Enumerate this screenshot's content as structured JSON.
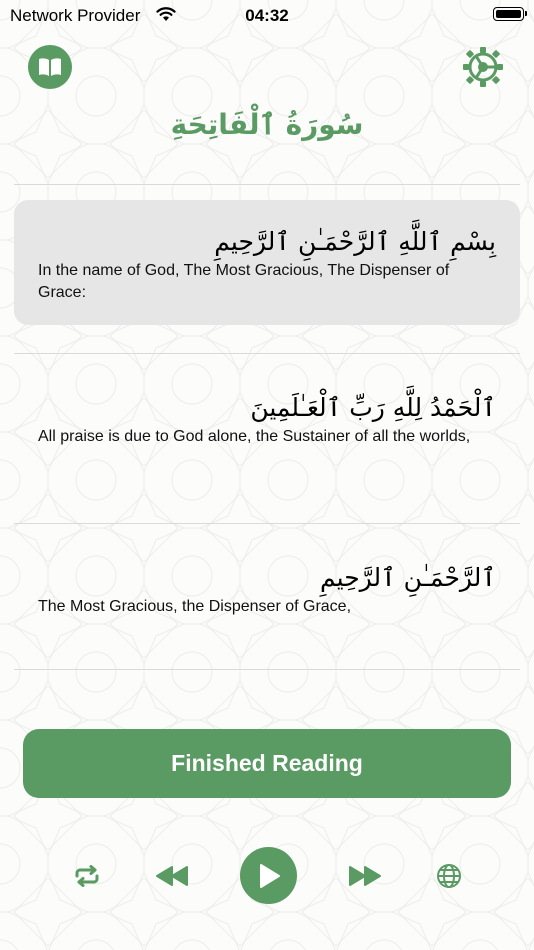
{
  "status_bar": {
    "carrier": "Network Provider",
    "time": "04:32"
  },
  "header": {
    "book_icon": "book-icon",
    "settings_icon": "gear-icon",
    "surah_title": "سُورَةُ ٱلْفَاتِحَةِ"
  },
  "verses": [
    {
      "arabic": "بِسْمِ ٱللَّهِ ٱلرَّحْمَـٰنِ ٱلرَّحِيمِ",
      "translation": "In the name of God, The Most Gracious, The Dispenser of Grace:",
      "highlighted": true
    },
    {
      "arabic": "ٱلْحَمْدُ لِلَّهِ رَبِّ ٱلْعَـٰلَمِينَ",
      "translation": "All praise is due to God alone, the Sustainer of all the worlds,",
      "highlighted": false
    },
    {
      "arabic": "ٱلرَّحْمَـٰنِ ٱلرَّحِيمِ",
      "translation": "The Most Gracious, the Dispenser of Grace,",
      "highlighted": false
    }
  ],
  "finish_button_label": "Finished Reading",
  "player": {
    "repeat_icon": "repeat-icon",
    "rewind_icon": "rewind-icon",
    "play_icon": "play-icon",
    "forward_icon": "fast-forward-icon",
    "language_icon": "globe-icon"
  },
  "colors": {
    "accent": "#5a9a63",
    "highlight_bg": "#e6e6e6",
    "divider": "#dadada"
  }
}
